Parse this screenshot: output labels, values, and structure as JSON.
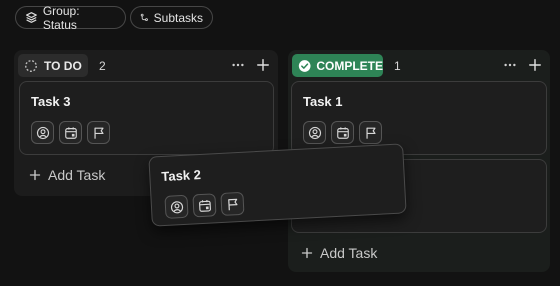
{
  "toolbar": {
    "group_label": "Group: Status",
    "subtasks_label": "Subtasks"
  },
  "columns": [
    {
      "status": "TO DO",
      "count": "2",
      "add_label": "Add Task",
      "cards": [
        {
          "title": "Task 3"
        }
      ]
    },
    {
      "status": "COMPLETE",
      "count": "1",
      "add_label": "Add Task",
      "cards": [
        {
          "title": "Task 1"
        }
      ]
    }
  ],
  "dragging_card": {
    "title": "Task 2"
  },
  "colors": {
    "background": "#121212",
    "column": "#1c1c1c",
    "complete_badge": "#2e8456",
    "card_border": "#3c3c3c"
  },
  "icons": [
    "layers-icon",
    "subtasks-icon",
    "circle-dashed-icon",
    "check-circle-icon",
    "more-icon",
    "plus-icon",
    "assignee-icon",
    "calendar-icon",
    "flag-icon"
  ]
}
